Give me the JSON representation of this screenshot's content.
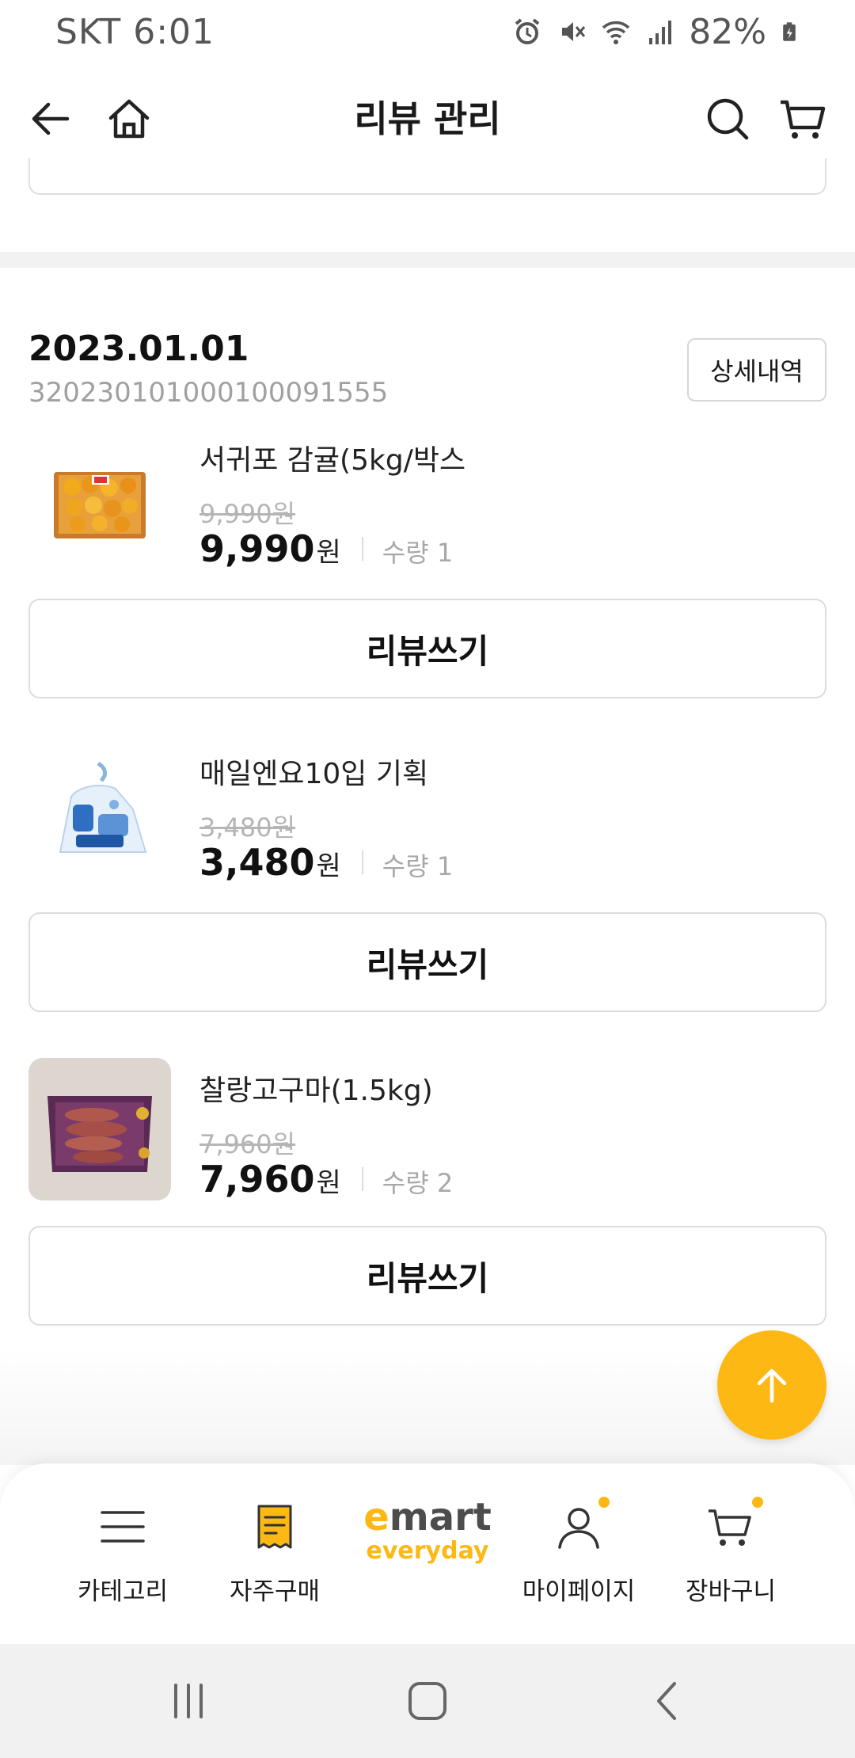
{
  "status_bar": {
    "carrier_time": "SKT 6:01",
    "battery": "82%"
  },
  "header": {
    "title": "리뷰 관리"
  },
  "order": {
    "date": "2023.01.01",
    "order_number": "320230101000100091555",
    "detail_label": "상세내역"
  },
  "items": [
    {
      "name": "서귀포 감귤(5kg/박스",
      "original_price": "9,990원",
      "price": "9,990",
      "unit": "원",
      "qty": "수량 1",
      "review_label": "리뷰쓰기"
    },
    {
      "name": "매일엔요10입 기획",
      "original_price": "3,480원",
      "price": "3,480",
      "unit": "원",
      "qty": "수량 1",
      "review_label": "리뷰쓰기"
    },
    {
      "name": "찰랑고구마(1.5kg)",
      "original_price": "7,960원",
      "price": "7,960",
      "unit": "원",
      "qty": "수량 2",
      "review_label": "리뷰쓰기"
    }
  ],
  "bottom_nav": {
    "category": "카테고리",
    "frequent": "자주구매",
    "mypage": "마이페이지",
    "cart": "장바구니"
  },
  "colors": {
    "accent": "#fdb813",
    "text": "#1a1a1a",
    "muted": "#a0a0a0"
  }
}
